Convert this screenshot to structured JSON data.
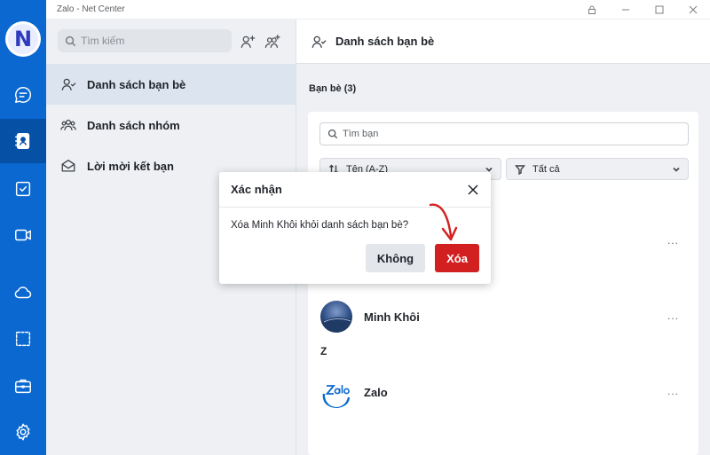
{
  "window": {
    "title": "Zalo - Net Center"
  },
  "rail": {
    "avatar_letter": "N",
    "items": [
      {
        "name": "chat-icon",
        "active": false
      },
      {
        "name": "contacts-icon",
        "active": true
      },
      {
        "name": "todo-icon",
        "active": false
      },
      {
        "name": "video-icon",
        "active": false
      },
      {
        "name": "cloud-icon",
        "active": false
      },
      {
        "name": "screenshot-icon",
        "active": false
      },
      {
        "name": "briefcase-icon",
        "active": false
      },
      {
        "name": "gear-icon",
        "active": false
      }
    ]
  },
  "sidebar": {
    "search_placeholder": "Tìm kiếm",
    "menu": [
      {
        "label": "Danh sách bạn bè",
        "active": true
      },
      {
        "label": "Danh sách nhóm",
        "active": false
      },
      {
        "label": "Lời mời kết bạn",
        "active": false
      }
    ]
  },
  "main": {
    "header_title": "Danh sách bạn bè",
    "friend_count": "Bạn bè (3)",
    "search_placeholder": "Tìm bạn",
    "sort_label": "Tên (A-Z)",
    "filter_label": "Tất cả",
    "friends": [
      {
        "letter": "",
        "name": "Minh Khôi"
      },
      {
        "letter": "Z",
        "name": "Zalo"
      }
    ],
    "more_label": "..."
  },
  "dialog": {
    "title": "Xác nhận",
    "message": "Xóa Minh Khôi khỏi danh sách bạn bè?",
    "cancel_label": "Không",
    "confirm_label": "Xóa"
  },
  "colors": {
    "rail": "#0a68d0",
    "danger": "#d21f1f",
    "annotation_arrow": "#d21f1f"
  }
}
